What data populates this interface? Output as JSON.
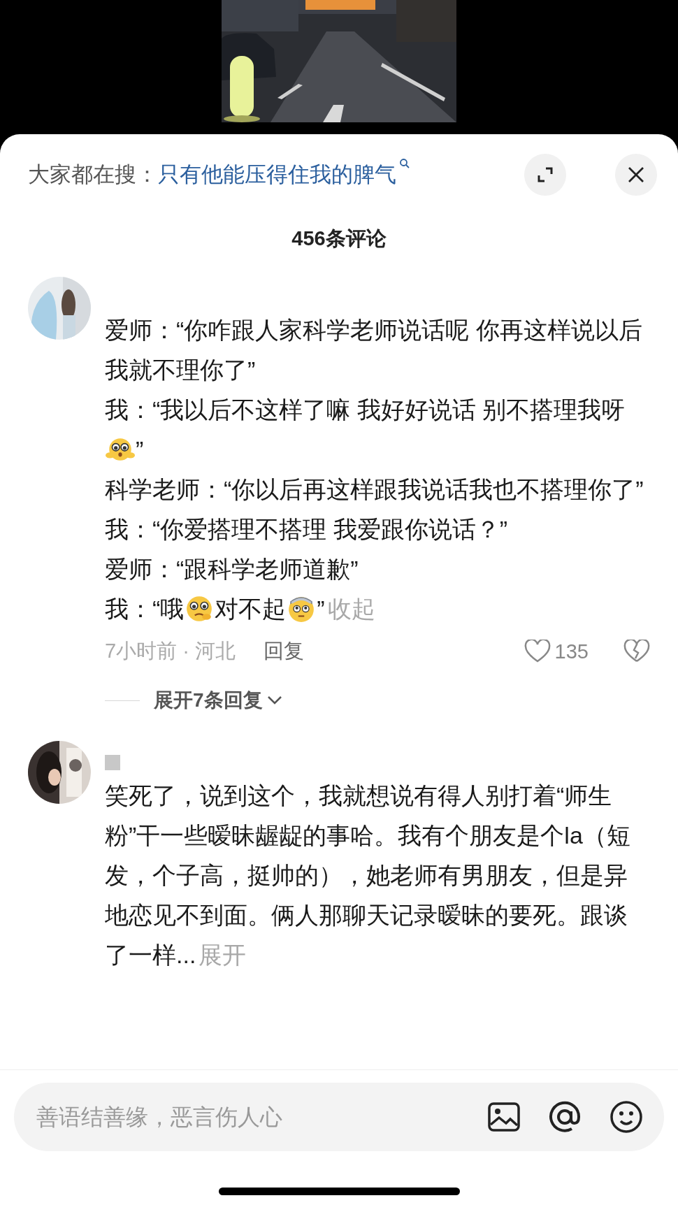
{
  "search_bar": {
    "label": "大家都在搜：",
    "query": "只有他能压得住我的脾气"
  },
  "comment_count": "456条评论",
  "comments": [
    {
      "redacted_name": false,
      "paragraphs": [
        [
          {
            "kind": "text",
            "text": "爱师：“你咋跟人家科学老师说话呢 你再这样说以后我就不理你了”"
          }
        ],
        [
          {
            "kind": "text",
            "text": "我：“我以后不这样了嘛 我好好说话 别不搭理我呀"
          },
          {
            "kind": "emoji"
          },
          {
            "kind": "text",
            "text": "”"
          }
        ],
        [
          {
            "kind": "text",
            "text": "科学老师：“你以后再这样跟我说话我也不搭理你了”"
          }
        ],
        [
          {
            "kind": "text",
            "text": "我：“你爱搭理不搭理 我爱跟你说话？”"
          }
        ],
        [
          {
            "kind": "text",
            "text": "爱师：“跟科学老师道歉”"
          }
        ],
        [
          {
            "kind": "text",
            "text": "我：“哦"
          },
          {
            "kind": "emoji"
          },
          {
            "kind": "text",
            "text": "对不起"
          },
          {
            "kind": "emoji"
          },
          {
            "kind": "text",
            "text": "”"
          },
          {
            "kind": "toggle",
            "text": "收起"
          }
        ]
      ],
      "meta": {
        "time_location": "7小时前 · 河北",
        "reply": "回复",
        "likes": "135"
      },
      "expand_replies": "展开7条回复"
    },
    {
      "redacted_name": true,
      "paragraphs": [
        [
          {
            "kind": "text",
            "text": "笑死了，说到这个，我就想说有得人别打着“师生粉”干一些暧昧龌龊的事哈。我有个朋友是个la（短发，个子高，挺帅的），她老师有男朋友，但是异地恋见不到面。俩人那聊天记录暧昧的要死。跟谈了一样..."
          },
          {
            "kind": "toggle",
            "text": "展开"
          }
        ]
      ]
    }
  ],
  "input": {
    "placeholder": "善语结善缘，恶言伤人心"
  }
}
